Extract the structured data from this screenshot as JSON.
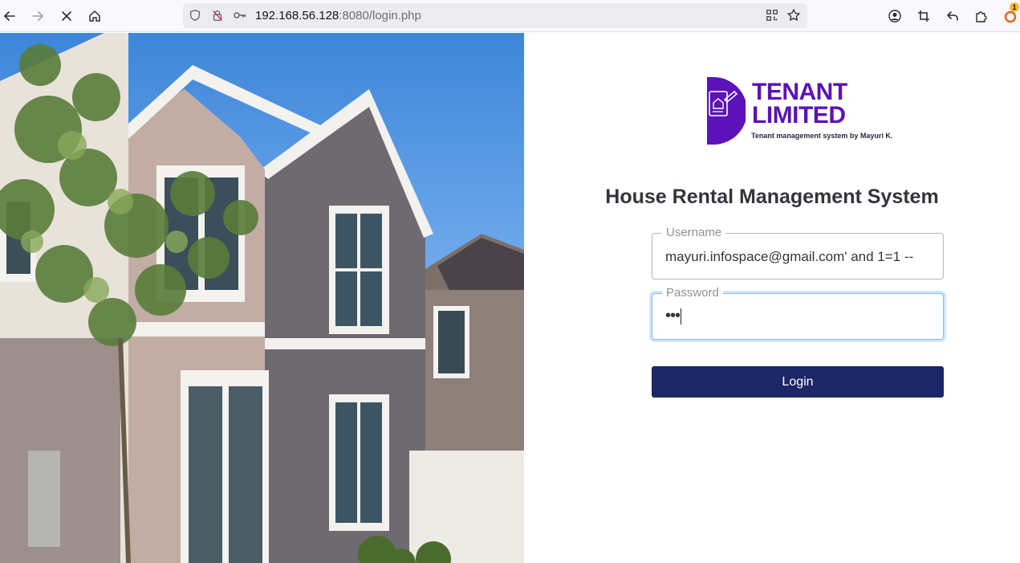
{
  "browser": {
    "url_host": "192.168.56.128",
    "url_rest": ":8080/login.php",
    "extension_badge": "1"
  },
  "logo": {
    "line1": "TENANT",
    "line2": "LIMITED",
    "tagline": "Tenant management system by Mayuri K.",
    "color": "#5b12b8"
  },
  "page": {
    "title": "House Rental Management System"
  },
  "form": {
    "username_label": "Username",
    "username_value": "mayuri.infospace@gmail.com' and 1=1 --",
    "password_label": "Password",
    "password_value": "•••",
    "login_label": "Login",
    "button_color": "#1b2766"
  }
}
